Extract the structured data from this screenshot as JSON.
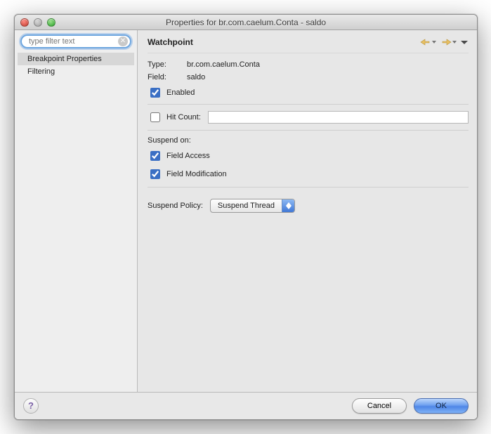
{
  "window": {
    "title": "Properties for br.com.caelum.Conta - saldo"
  },
  "sidebar": {
    "filter_placeholder": "type filter text",
    "items": [
      {
        "label": "Breakpoint Properties",
        "selected": true
      },
      {
        "label": "Filtering",
        "selected": false
      }
    ]
  },
  "main": {
    "heading": "Watchpoint",
    "type_label": "Type:",
    "type_value": "br.com.caelum.Conta",
    "field_label": "Field:",
    "field_value": "saldo",
    "enabled_label": "Enabled",
    "enabled_checked": true,
    "hitcount_label": "Hit Count:",
    "hitcount_checked": false,
    "hitcount_value": "",
    "suspend_on_label": "Suspend on:",
    "field_access_label": "Field Access",
    "field_access_checked": true,
    "field_mod_label": "Field Modification",
    "field_mod_checked": true,
    "suspend_policy_label": "Suspend Policy:",
    "suspend_policy_value": "Suspend Thread"
  },
  "footer": {
    "cancel": "Cancel",
    "ok": "OK"
  }
}
